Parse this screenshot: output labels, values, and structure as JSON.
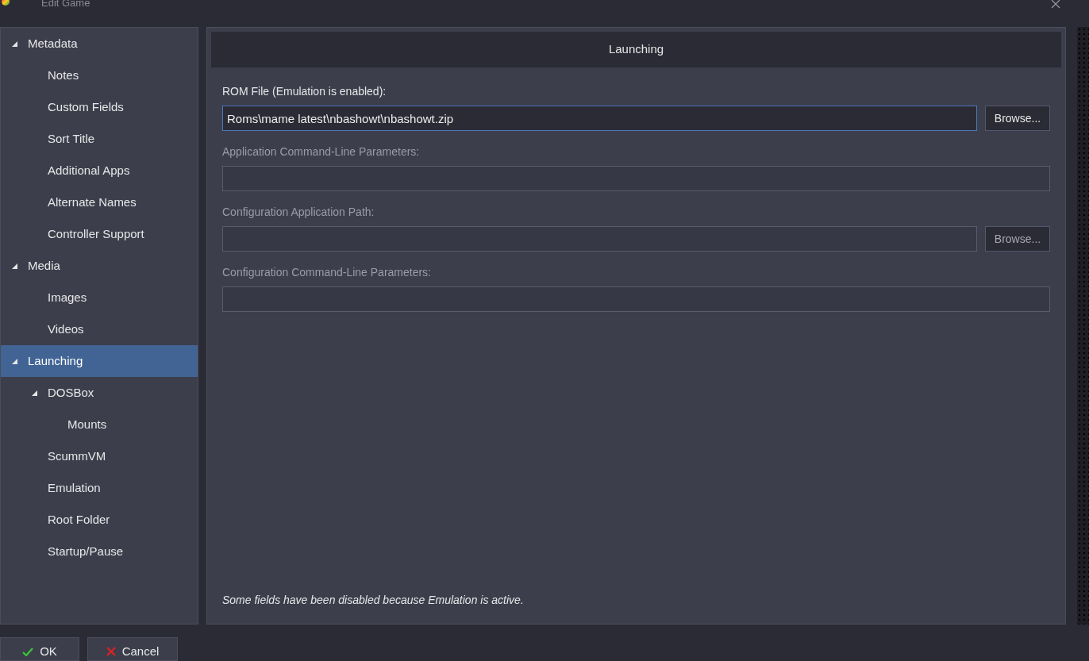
{
  "window": {
    "title": "Edit Game"
  },
  "sidebar": {
    "items": [
      {
        "label": "Metadata",
        "selected": false,
        "expanded": true,
        "children": [
          {
            "label": "Notes",
            "selected": false
          },
          {
            "label": "Custom Fields",
            "selected": false
          },
          {
            "label": "Sort Title",
            "selected": false
          },
          {
            "label": "Additional Apps",
            "selected": false
          },
          {
            "label": "Alternate Names",
            "selected": false
          },
          {
            "label": "Controller Support",
            "selected": false
          }
        ]
      },
      {
        "label": "Media",
        "selected": false,
        "expanded": true,
        "children": [
          {
            "label": "Images",
            "selected": false
          },
          {
            "label": "Videos",
            "selected": false
          }
        ]
      },
      {
        "label": "Launching",
        "selected": true,
        "expanded": true,
        "children": [
          {
            "label": "DOSBox",
            "selected": false,
            "expanded": true,
            "children": [
              {
                "label": "Mounts",
                "selected": false
              }
            ]
          },
          {
            "label": "ScummVM",
            "selected": false
          },
          {
            "label": "Emulation",
            "selected": false
          },
          {
            "label": "Root Folder",
            "selected": false
          },
          {
            "label": "Startup/Pause",
            "selected": false
          }
        ]
      }
    ]
  },
  "panel": {
    "title": "Launching",
    "fields": [
      {
        "label": "ROM File (Emulation is enabled):",
        "value": "Roms\\mame latest\\nbashowt\\nbashowt.zip",
        "disabled": false,
        "focused": true,
        "button": "Browse..."
      },
      {
        "label": "Application Command-Line Parameters:",
        "disabled": true,
        "focused": false
      },
      {
        "label": "Configuration Application Path:",
        "disabled": true,
        "focused": false,
        "button": "Browse..."
      },
      {
        "label": "Configuration Command-Line Parameters:",
        "disabled": true,
        "focused": false
      }
    ],
    "note": "Some fields have been disabled because Emulation is active."
  },
  "buttons": [
    {
      "label": "OK",
      "kind": "ok"
    },
    {
      "label": "Cancel",
      "kind": "cancel"
    }
  ]
}
